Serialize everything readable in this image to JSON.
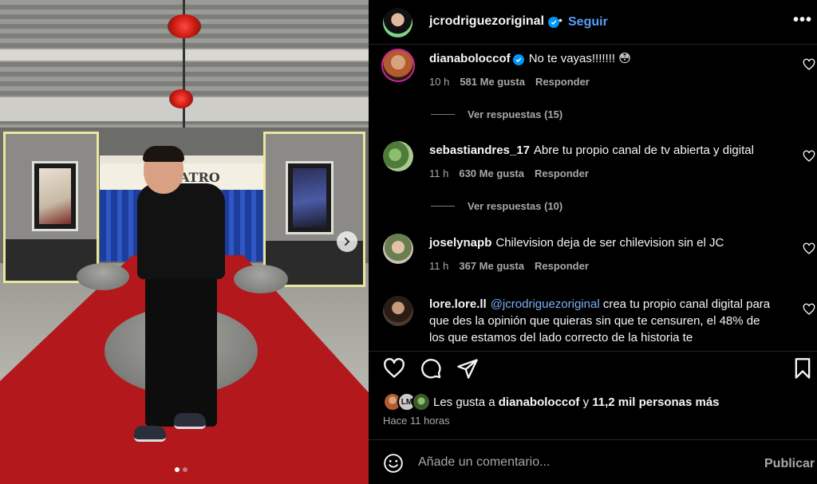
{
  "post": {
    "author": "jcrodriguezoriginal",
    "follow_label": "Seguir",
    "separator": "•",
    "more_label": "•••",
    "marquee_text": "ATRO",
    "slide_index": 1,
    "slide_count": 2
  },
  "comments": [
    {
      "user": "dianaboloccof",
      "verified": true,
      "text": "No te vayas!!!!!!! 😳",
      "time": "10 h",
      "likes": "581 Me gusta",
      "reply_label": "Responder",
      "view_replies": "Ver respuestas (15)"
    },
    {
      "user": "sebastiandres_17",
      "verified": false,
      "text": "Abre tu propio canal de tv abierta y digital",
      "time": "11 h",
      "likes": "630 Me gusta",
      "reply_label": "Responder",
      "view_replies": "Ver respuestas (10)"
    },
    {
      "user": "joselynapb",
      "verified": false,
      "text": "Chilevision deja de ser chilevision sin el JC",
      "time": "11 h",
      "likes": "367 Me gusta",
      "reply_label": "Responder"
    },
    {
      "user": "lore.lore.ll",
      "verified": false,
      "mention": "@jcrodriguezoriginal",
      "text": "crea tu propio canal digital para que des la opinión que quieras sin que te censuren, el 48% de los que estamos del lado correcto de la historia te"
    }
  ],
  "likes_summary": {
    "prefix": "Les gusta a",
    "user": "dianaboloccof",
    "connector": "y",
    "count": "11,2 mil personas más",
    "mini_avatar_text": "LM"
  },
  "time_ago": "Hace 11 horas",
  "composer": {
    "placeholder": "Añade un comentario...",
    "publish_label": "Publicar"
  },
  "colors": {
    "accent": "#0095f6",
    "follow": "#5c9cf6",
    "mention": "#7ab0f8",
    "muted": "#a8a8a8",
    "carpet": "#b3181d"
  }
}
